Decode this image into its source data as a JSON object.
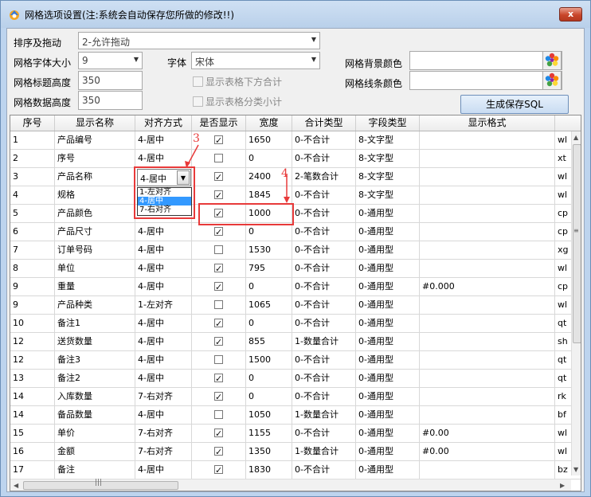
{
  "window": {
    "title": "网格选项设置(注:系统会自动保存您所做的修改!!)",
    "close_label": "x"
  },
  "settings": {
    "sort_drag_label": "排序及拖动",
    "sort_drag_value": "2-允许拖动",
    "font_size_label": "网格字体大小",
    "font_size_value": "9",
    "font_label": "字体",
    "font_value": "宋体",
    "title_height_label": "网格标题高度",
    "title_height_value": "350",
    "data_height_label": "网格数据高度",
    "data_height_value": "350",
    "show_total_label": "显示表格下方合计",
    "show_subtotal_label": "显示表格分类小计",
    "bg_color_label": "网格背景颜色",
    "line_color_label": "网格线条颜色",
    "generate_label": "生成保存SQL"
  },
  "grid": {
    "columns": [
      "序号",
      "显示名称",
      "对齐方式",
      "是否显示",
      "宽度",
      "合计类型",
      "字段类型",
      "显示格式",
      ""
    ],
    "rows": [
      {
        "no": "1",
        "name": "产品编号",
        "align": "4-居中",
        "show": true,
        "width": "1650",
        "sum": "0-不合计",
        "ftype": "8-文字型",
        "fmt": "",
        "extra": "wl"
      },
      {
        "no": "2",
        "name": "序号",
        "align": "4-居中",
        "show": false,
        "width": "0",
        "sum": "0-不合计",
        "ftype": "8-文字型",
        "fmt": "",
        "extra": "xt"
      },
      {
        "no": "3",
        "name": "产品名称",
        "align": "",
        "show": true,
        "width": "2400",
        "sum": "2-笔数合计",
        "ftype": "8-文字型",
        "fmt": "",
        "extra": "wl"
      },
      {
        "no": "4",
        "name": "规格",
        "align": "",
        "show": true,
        "width": "1845",
        "sum": "0-不合计",
        "ftype": "8-文字型",
        "fmt": "",
        "extra": "wl"
      },
      {
        "no": "5",
        "name": "产品颜色",
        "align": "",
        "show": true,
        "width": "1000",
        "sum": "0-不合计",
        "ftype": "0-通用型",
        "fmt": "",
        "extra": "cp"
      },
      {
        "no": "6",
        "name": "产品尺寸",
        "align": "4-居中",
        "show": true,
        "width": "0",
        "sum": "0-不合计",
        "ftype": "0-通用型",
        "fmt": "",
        "extra": "cp"
      },
      {
        "no": "7",
        "name": "订单号码",
        "align": "4-居中",
        "show": false,
        "width": "1530",
        "sum": "0-不合计",
        "ftype": "0-通用型",
        "fmt": "",
        "extra": "xg"
      },
      {
        "no": "8",
        "name": "单位",
        "align": "4-居中",
        "show": true,
        "width": "795",
        "sum": "0-不合计",
        "ftype": "0-通用型",
        "fmt": "",
        "extra": "wl"
      },
      {
        "no": "9",
        "name": "重量",
        "align": "4-居中",
        "show": true,
        "width": "0",
        "sum": "0-不合计",
        "ftype": "0-通用型",
        "fmt": "#0.000",
        "extra": "cp"
      },
      {
        "no": "9",
        "name": "产品种类",
        "align": "1-左对齐",
        "show": false,
        "width": "1065",
        "sum": "0-不合计",
        "ftype": "0-通用型",
        "fmt": "",
        "extra": "wl"
      },
      {
        "no": "10",
        "name": "备注1",
        "align": "4-居中",
        "show": true,
        "width": "0",
        "sum": "0-不合计",
        "ftype": "0-通用型",
        "fmt": "",
        "extra": "qt"
      },
      {
        "no": "12",
        "name": "送货数量",
        "align": "4-居中",
        "show": true,
        "width": "855",
        "sum": "1-数量合计",
        "ftype": "0-通用型",
        "fmt": "",
        "extra": "sh"
      },
      {
        "no": "12",
        "name": "备注3",
        "align": "4-居中",
        "show": false,
        "width": "1500",
        "sum": "0-不合计",
        "ftype": "0-通用型",
        "fmt": "",
        "extra": "qt"
      },
      {
        "no": "13",
        "name": "备注2",
        "align": "4-居中",
        "show": true,
        "width": "0",
        "sum": "0-不合计",
        "ftype": "0-通用型",
        "fmt": "",
        "extra": "qt"
      },
      {
        "no": "14",
        "name": "入库数量",
        "align": "7-右对齐",
        "show": true,
        "width": "0",
        "sum": "0-不合计",
        "ftype": "0-通用型",
        "fmt": "",
        "extra": "rk"
      },
      {
        "no": "14",
        "name": "备品数量",
        "align": "4-居中",
        "show": false,
        "width": "1050",
        "sum": "1-数量合计",
        "ftype": "0-通用型",
        "fmt": "",
        "extra": "bf"
      },
      {
        "no": "15",
        "name": "单价",
        "align": "7-右对齐",
        "show": true,
        "width": "1155",
        "sum": "0-不合计",
        "ftype": "0-通用型",
        "fmt": "#0.00",
        "extra": "wl"
      },
      {
        "no": "16",
        "name": "金额",
        "align": "7-右对齐",
        "show": true,
        "width": "1350",
        "sum": "1-数量合计",
        "ftype": "0-通用型",
        "fmt": "#0.00",
        "extra": "wl"
      },
      {
        "no": "17",
        "name": "备注",
        "align": "4-居中",
        "show": true,
        "width": "1830",
        "sum": "0-不合计",
        "ftype": "0-通用型",
        "fmt": "",
        "extra": "bz"
      }
    ]
  },
  "editor": {
    "value": "4-居中",
    "options": [
      "1-左对齐",
      "4-居中",
      "7-右对齐"
    ],
    "selected_index": 1
  },
  "annotations": {
    "label_3": "3",
    "label_4": "4",
    "color": "#e83a3a"
  },
  "icons": {
    "app": "app-icon",
    "color_picker": "flower-icon"
  }
}
